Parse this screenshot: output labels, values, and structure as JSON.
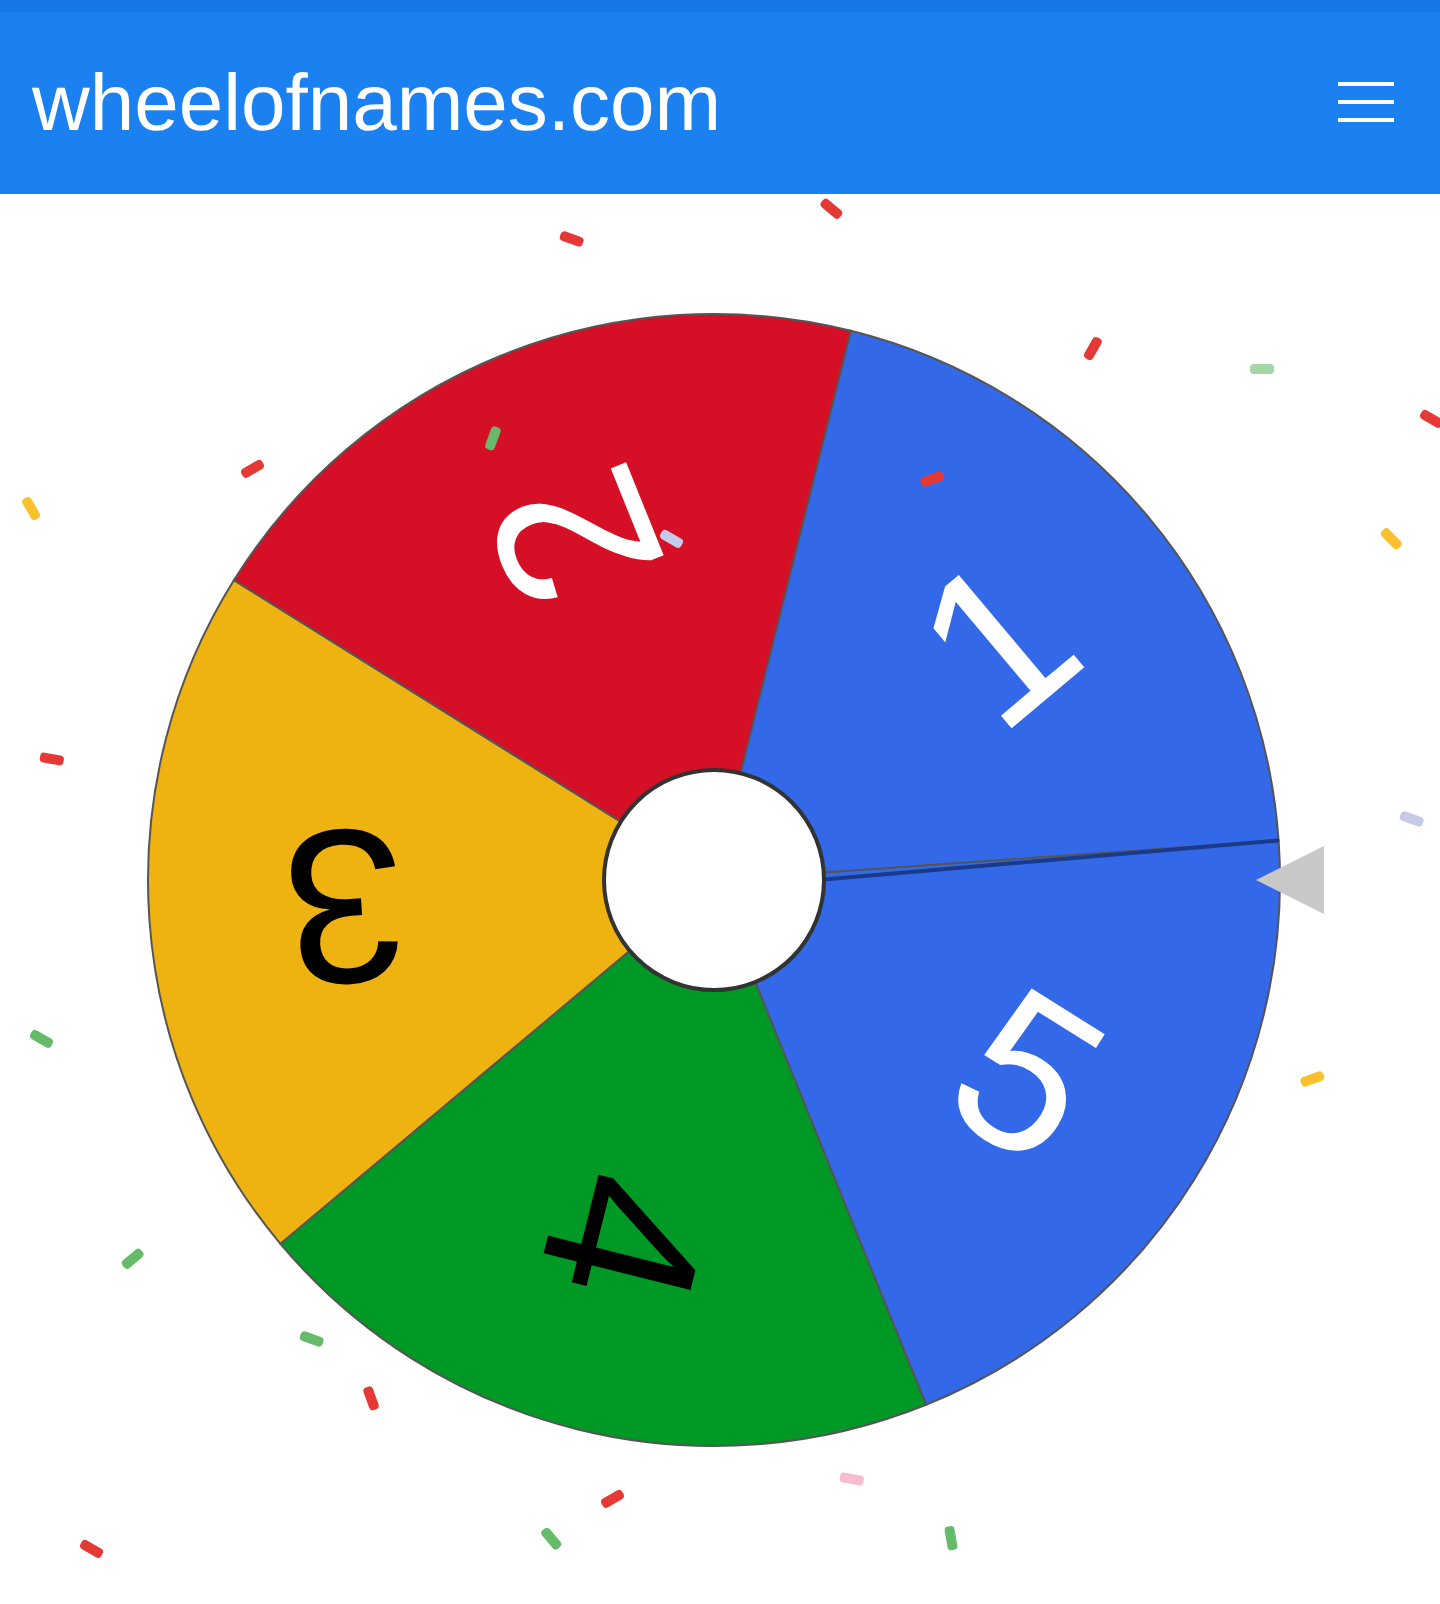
{
  "header": {
    "title": "wheelofnames.com"
  },
  "wheel": {
    "segments": [
      {
        "label": "5",
        "color": "#3369e8",
        "dark_label": false
      },
      {
        "label": "4",
        "color": "#009925",
        "dark_label": true
      },
      {
        "label": "3",
        "color": "#eeb211",
        "dark_label": true
      },
      {
        "label": "2",
        "color": "#d50f25",
        "dark_label": false
      },
      {
        "label": "1",
        "color": "#3369e8",
        "dark_label": false
      }
    ]
  }
}
